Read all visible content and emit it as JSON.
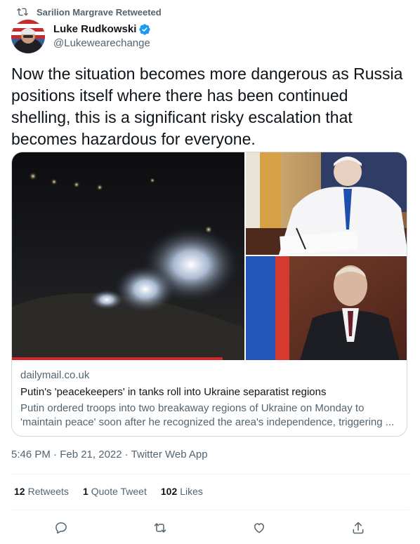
{
  "retweet": {
    "text": "Sarilion Margrave Retweeted",
    "icon": "retweet-icon"
  },
  "author": {
    "display_name": "Luke Rudkowski",
    "handle": "@Lukewearechange",
    "verified": true,
    "verified_color": "#1d9bf0"
  },
  "tweet": {
    "text": "Now the situation becomes more dangerous as Russia positions itself where there has been continued shelling, this is a significant risky escalation that becomes hazardous for everyone."
  },
  "card": {
    "domain": "dailymail.co.uk",
    "title": "Putin's 'peacekeepers' in tanks roll into Ukraine separatist regions",
    "description": "Putin ordered troops into two breakaway regions of Ukraine on Monday to 'maintain peace' soon after he recognized the area's independence, triggering ..."
  },
  "timestamp": "5:46 PM · Feb 21, 2022 · Twitter Web App",
  "stats": {
    "retweets_count": "12",
    "retweets_label": "Retweets",
    "quotes_count": "1",
    "quotes_label": "Quote Tweet",
    "likes_count": "102",
    "likes_label": "Likes"
  },
  "actions": [
    "reply-icon",
    "retweet-icon",
    "like-icon",
    "share-icon"
  ],
  "colors": {
    "text": "#0f1419",
    "secondary": "#536471",
    "border": "#cfd9de",
    "divider": "#eff3f4"
  }
}
